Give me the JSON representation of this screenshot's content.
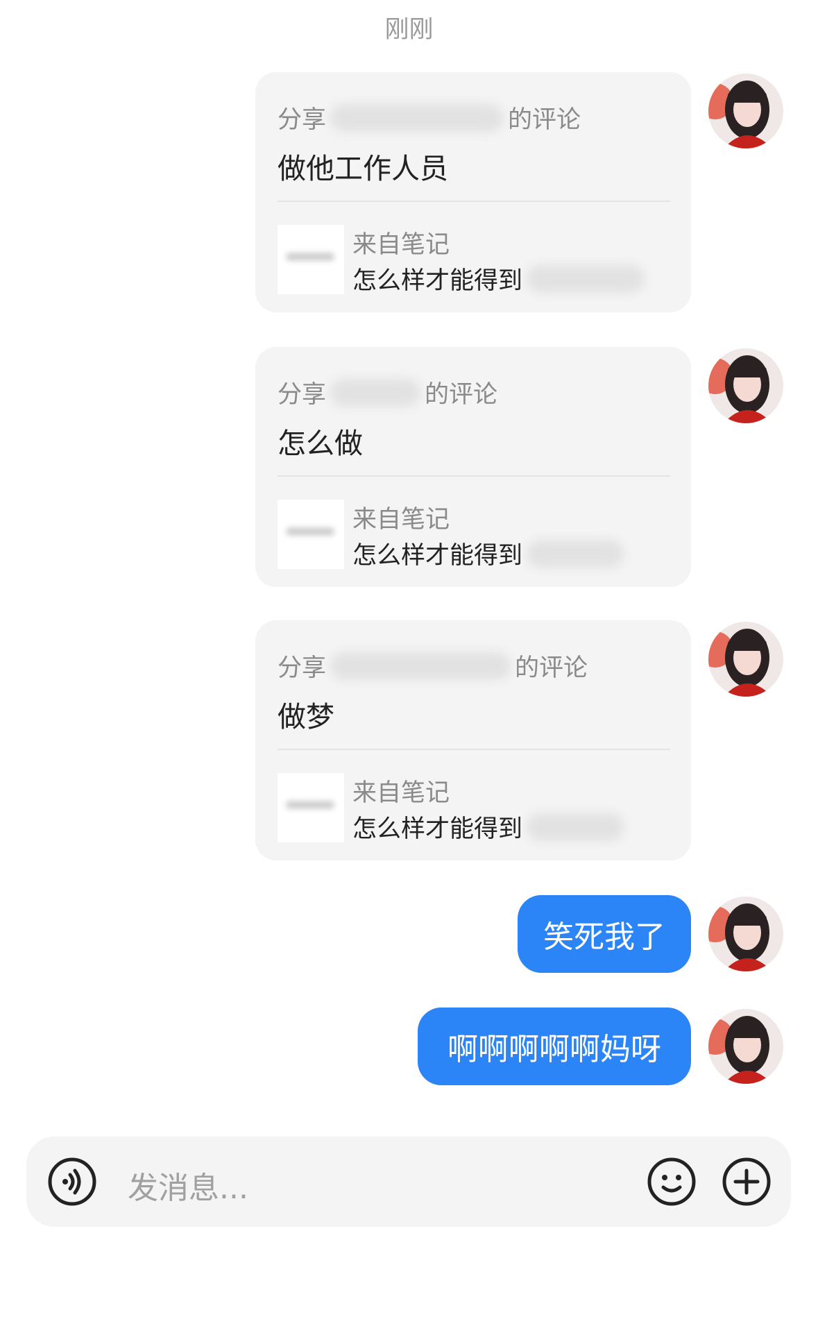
{
  "chat": {
    "timestamp": "刚刚",
    "shared_comments": [
      {
        "share_prefix": "分享",
        "share_suffix": "的评论",
        "comment": "做他工作人员",
        "note_label": "来自笔记",
        "note_title": "怎么样才能得到"
      },
      {
        "share_prefix": "分享",
        "share_suffix": "的评论",
        "comment": "怎么做",
        "note_label": "来自笔记",
        "note_title": "怎么样才能得到"
      },
      {
        "share_prefix": "分享",
        "share_suffix": "的评论",
        "comment": "做梦",
        "note_label": "来自笔记",
        "note_title": "怎么样才能得到"
      }
    ],
    "text_messages": [
      {
        "text": "笑死我了"
      },
      {
        "text": "啊啊啊啊啊妈呀"
      }
    ]
  },
  "input_bar": {
    "placeholder": "发消息...",
    "voice_icon": "voice-icon",
    "emoji_icon": "emoji-icon",
    "add_icon": "plus-circle-icon"
  },
  "colors": {
    "bubble_blue": "#2b85f6",
    "card_bg": "#f4f4f5"
  }
}
